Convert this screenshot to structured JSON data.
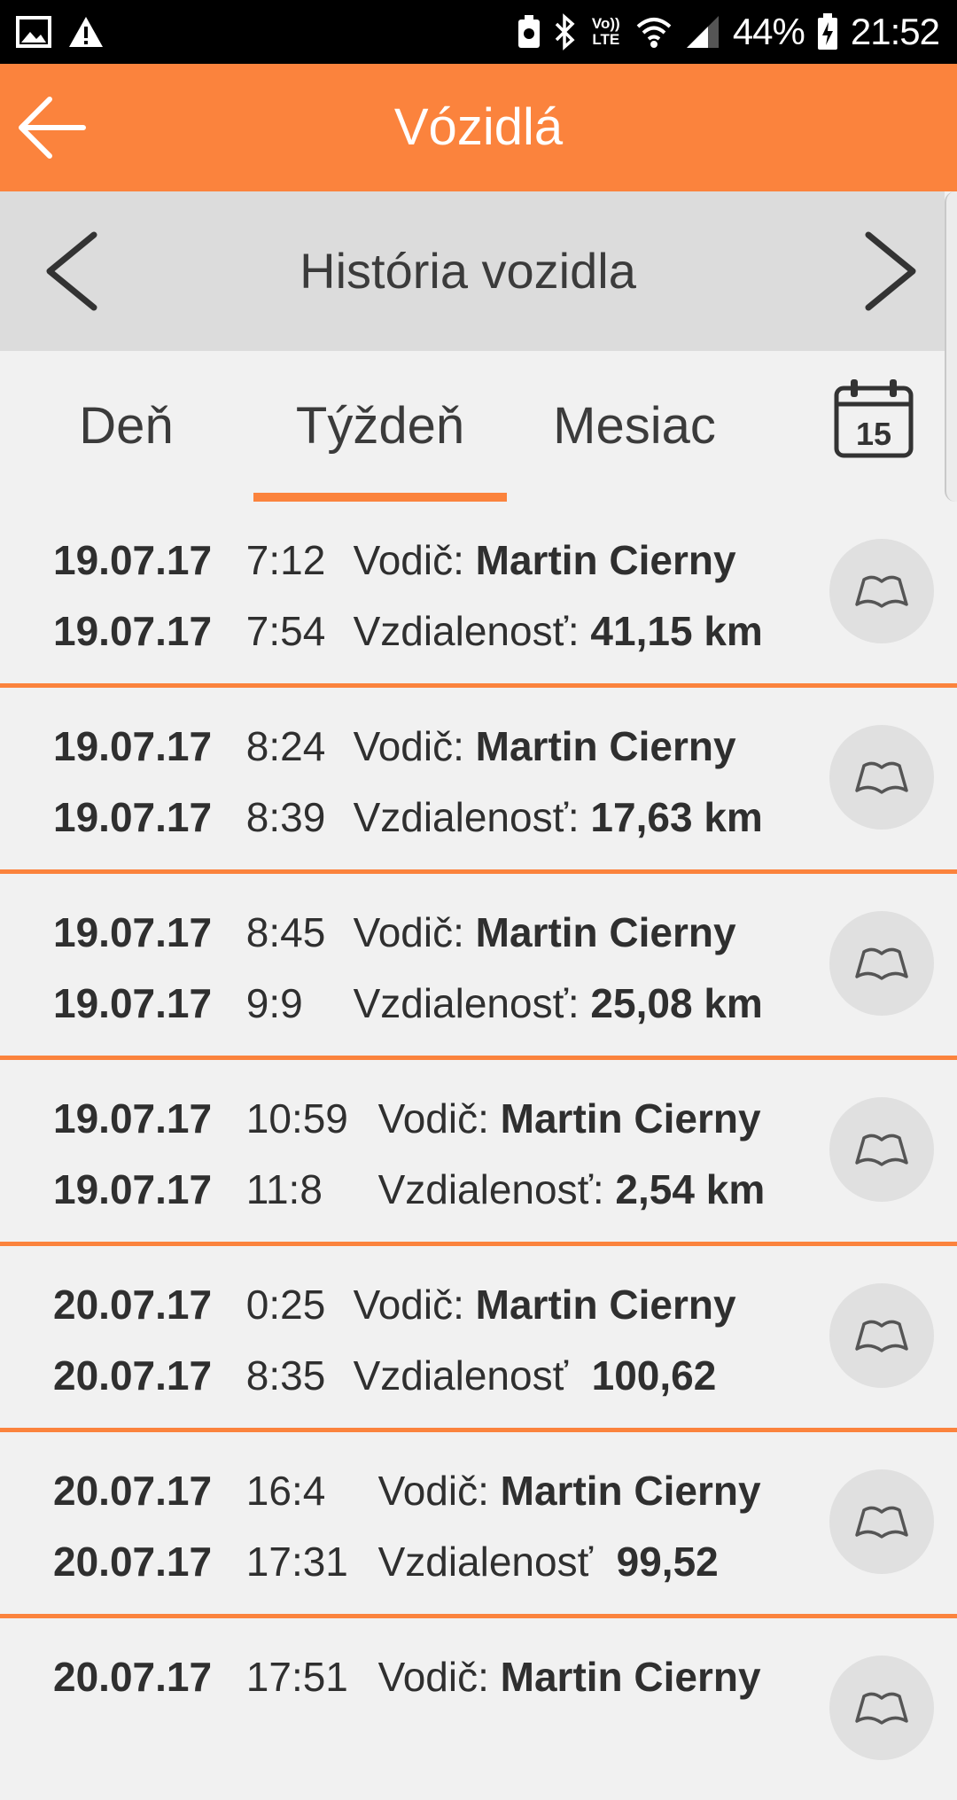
{
  "status_bar": {
    "battery": "44%",
    "time": "21:52",
    "icons": [
      "image-icon",
      "warning-icon",
      "battery-saver-icon",
      "bluetooth-icon",
      "volte-icon",
      "wifi-icon",
      "signal-icon",
      "battery-icon"
    ],
    "volte_label": "Vo)) LTE"
  },
  "app_bar": {
    "title": "Vózidlá"
  },
  "history_nav": {
    "title": "História vozidla"
  },
  "tabs": [
    {
      "label": "Deň",
      "active": false
    },
    {
      "label": "Týždeň",
      "active": true
    },
    {
      "label": "Mesiac",
      "active": false
    }
  ],
  "calendar_day": "15",
  "accent_color": "#fb833d",
  "trips": [
    {
      "start_date": "19.07.17",
      "start_time": "7:12",
      "driver_label": "Vodič:",
      "driver": "Martin Cierny",
      "end_date": "19.07.17",
      "end_time": "7:54",
      "distance_label": "Vzdialenosť:",
      "distance": "41,15 km"
    },
    {
      "start_date": "19.07.17",
      "start_time": "8:24",
      "driver_label": "Vodič:",
      "driver": "Martin Cierny",
      "end_date": "19.07.17",
      "end_time": "8:39",
      "distance_label": "Vzdialenosť:",
      "distance": "17,63 km"
    },
    {
      "start_date": "19.07.17",
      "start_time": "8:45",
      "driver_label": "Vodič:",
      "driver": "Martin Cierny",
      "end_date": "19.07.17",
      "end_time": "9:9",
      "distance_label": "Vzdialenosť:",
      "distance": "25,08 km"
    },
    {
      "start_date": "19.07.17",
      "start_time": "10:59",
      "driver_label": "Vodič:",
      "driver": "Martin Cierny",
      "end_date": "19.07.17",
      "end_time": "11:8",
      "distance_label": "Vzdialenosť:",
      "distance": "2,54 km"
    },
    {
      "start_date": "20.07.17",
      "start_time": "0:25",
      "driver_label": "Vodič:",
      "driver": "Martin Cierny",
      "end_date": "20.07.17",
      "end_time": "8:35",
      "distance_label": "Vzdialenosť",
      "distance": "100,62"
    },
    {
      "start_date": "20.07.17",
      "start_time": "16:4",
      "driver_label": "Vodič:",
      "driver": "Martin Cierny",
      "end_date": "20.07.17",
      "end_time": "17:31",
      "distance_label": "Vzdialenosť",
      "distance": "99,52"
    },
    {
      "start_date": "20.07.17",
      "start_time": "17:51",
      "driver_label": "Vodič:",
      "driver": "Martin Cierny",
      "end_date": "",
      "end_time": "",
      "distance_label": "",
      "distance": ""
    }
  ]
}
